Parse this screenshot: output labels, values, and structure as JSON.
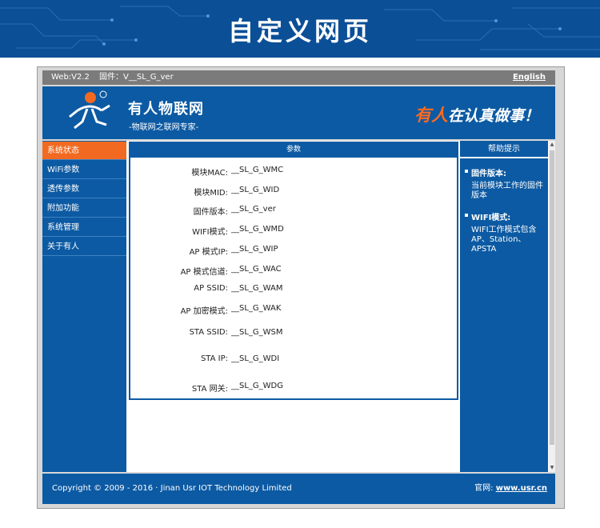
{
  "banner": {
    "heading": "自定义网页"
  },
  "topbar": {
    "web_version": "Web:V2.2",
    "firmware": "固件：V__SL_G_ver",
    "language_link": "English"
  },
  "header": {
    "brand_name": "有人物联网",
    "brand_sub": "-物联网之联网专家-",
    "slogan_accent": "有人",
    "slogan_rest": "在认真做事！"
  },
  "sidebar": {
    "items": [
      {
        "label": "系统状态",
        "active": true
      },
      {
        "label": "WiFi参数"
      },
      {
        "label": "透传参数"
      },
      {
        "label": "附加功能"
      },
      {
        "label": "系统管理"
      },
      {
        "label": "关于有人"
      }
    ]
  },
  "params": {
    "title": "参数",
    "rows": [
      {
        "label": "模块MAC:",
        "value": "__SL_G_WMC"
      },
      {
        "label": "模块MID:",
        "value": "__SL_G_WID"
      },
      {
        "label": "固件版本:",
        "value": "__SL_G_ver"
      },
      {
        "label": "WIFI模式:",
        "value": "__SL_G_WMD"
      },
      {
        "label": "AP 模式IP:",
        "value": "__SL_G_WIP"
      },
      {
        "label": "AP 模式信道:",
        "value": "__SL_G_WAC"
      },
      {
        "label": "AP SSID:",
        "value": "__SL_G_WAM"
      },
      {
        "label": "AP 加密模式:",
        "value": "__SL_G_WAK"
      },
      {
        "label": "STA SSID:",
        "value": "__SL_G_WSM"
      },
      {
        "label": "STA IP:",
        "value": "__SL_G_WDI"
      },
      {
        "label": "STA 网关:",
        "value": "__SL_G_WDG"
      }
    ]
  },
  "help": {
    "title": "帮助提示",
    "sections": [
      {
        "heading": "固件版本:",
        "text": "当前模块工作的固件版本"
      },
      {
        "heading": "WIFI模式:",
        "text": "WIFI工作模式包含AP、Station、APSTA"
      }
    ]
  },
  "footer": {
    "copyright": "Copyright © 2009 - 2016 · Jinan Usr IOT Technology Limited",
    "site_label": "官网:",
    "site_link": "www.usr.cn"
  },
  "colors": {
    "primary": "#0c5aa3",
    "accent": "#f26a21",
    "frame": "#d7d7d7"
  }
}
